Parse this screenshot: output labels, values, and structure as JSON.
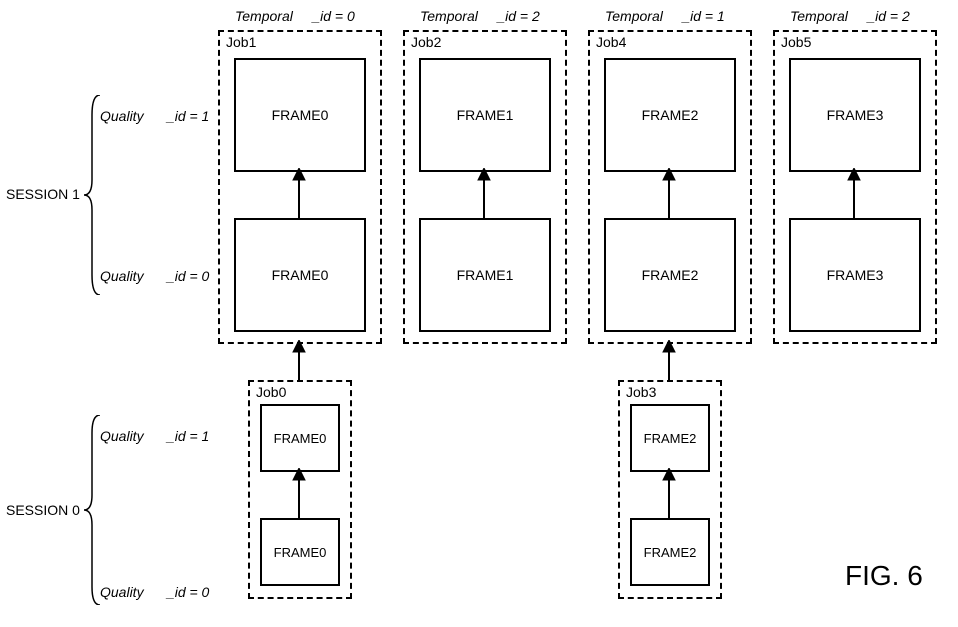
{
  "temporal": [
    {
      "word": "Temporal",
      "id": "_id = 0"
    },
    {
      "word": "Temporal",
      "id": "_id = 2"
    },
    {
      "word": "Temporal",
      "id": "_id = 1"
    },
    {
      "word": "Temporal",
      "id": "_id = 2"
    }
  ],
  "jobs": {
    "job1": {
      "title": "Job1",
      "top": "FRAME0",
      "bot": "FRAME0"
    },
    "job2": {
      "title": "Job2",
      "top": "FRAME1",
      "bot": "FRAME1"
    },
    "job4": {
      "title": "Job4",
      "top": "FRAME2",
      "bot": "FRAME2"
    },
    "job5": {
      "title": "Job5",
      "top": "FRAME3",
      "bot": "FRAME3"
    },
    "job0": {
      "title": "Job0",
      "top": "FRAME0",
      "bot": "FRAME0"
    },
    "job3": {
      "title": "Job3",
      "top": "FRAME2",
      "bot": "FRAME2"
    }
  },
  "sessions": {
    "s1": "SESSION 1",
    "s0": "SESSION 0"
  },
  "quality": {
    "q1w": "Quality",
    "q1i": "_id = 1",
    "q0w": "Quality",
    "q0i": "_id = 0"
  },
  "figure": "FIG. 6"
}
